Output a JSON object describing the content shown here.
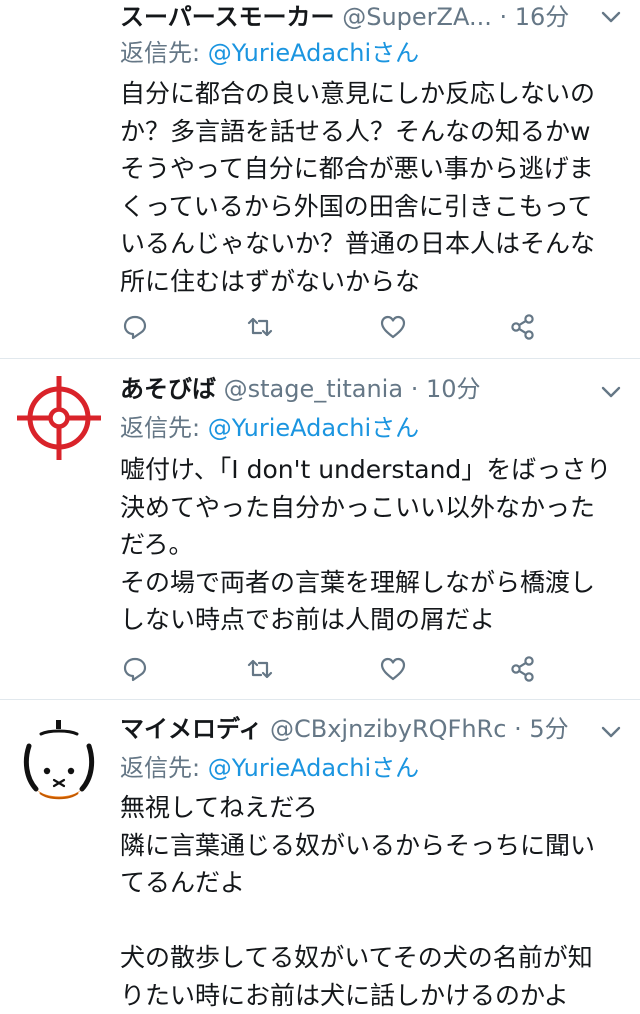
{
  "tweets": [
    {
      "name": "スーパースモーカー",
      "handle": "@SuperZA...",
      "dot": "·",
      "time": "16分",
      "reply_prefix": "返信先:",
      "reply_to": "@YurieAdachiさん",
      "lines": [
        "自分に都合の良い意見にしか反応しないの",
        "か？多言語を話せる人？そんなの知るかw",
        "そうやって自分に都合が悪い事から逃げま",
        "くっているから外国の田舎に引きこもって",
        "いるんじゃないか？普通の日本人はそんな",
        "所に住むはずがないからな"
      ]
    },
    {
      "name": "あそびば",
      "handle": "@stage_titania",
      "dot": "·",
      "time": "10分",
      "reply_prefix": "返信先:",
      "reply_to": "@YurieAdachiさん",
      "avatar": "crosshair-icon",
      "lines": [
        "嘘付け、「I don't understand」をばっさり",
        "決めてやった自分かっこいい以外なかった",
        "だろ。",
        "その場で両者の言葉を理解しながら橋渡し",
        "しない時点でお前は人間の屑だよ"
      ]
    },
    {
      "name": "マイメロディ",
      "handle": "@CBxjnzibyRQFhRc",
      "dot": "·",
      "time": "5分",
      "reply_prefix": "返信先:",
      "reply_to": "@YurieAdachiさん",
      "avatar": "miffy-face-icon",
      "lines": [
        "無視してねえだろ",
        "隣に言葉通じる奴がいるからそっちに聞い",
        "てるんだよ",
        "",
        "犬の散歩してる奴がいてその犬の名前が知",
        "りたい時にお前は犬に話しかけるのかよ"
      ]
    }
  ],
  "icons": {
    "reply": "reply-icon",
    "retweet": "retweet-icon",
    "like": "heart-icon",
    "share": "share-icon",
    "menu": "chevron-down-icon"
  },
  "colors": {
    "name": "#14171a",
    "meta": "#657786",
    "link": "#1b95e0",
    "divider": "#e1e8ed",
    "icon": "#657786"
  }
}
